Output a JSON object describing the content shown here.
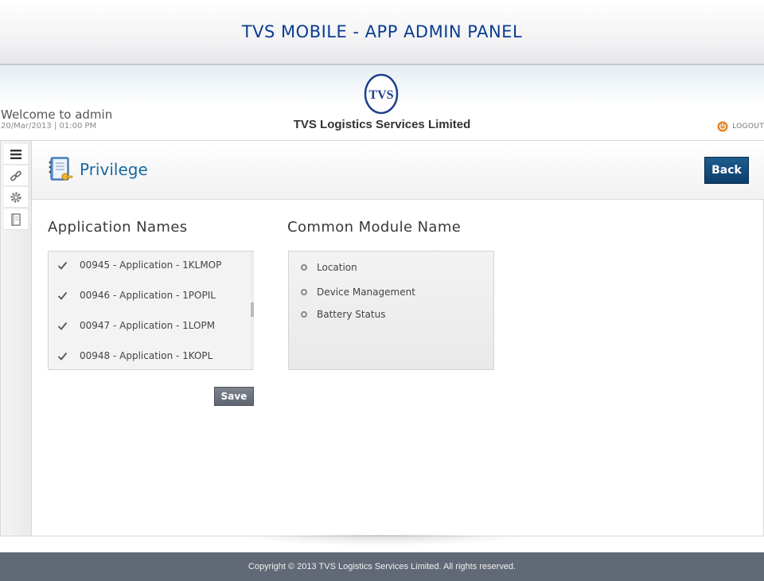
{
  "app": {
    "title": "TVS MOBILE - APP ADMIN PANEL"
  },
  "header": {
    "welcome": "Welcome to admin",
    "datetime": "20/Mar/2013 | 01:00 PM",
    "logo_text": "TVS",
    "company": "TVS Logistics Services Limited",
    "logout": "LOGOUT"
  },
  "sidebar": {
    "items": [
      {
        "icon": "menu-icon"
      },
      {
        "icon": "link-icon"
      },
      {
        "icon": "gear-icon"
      },
      {
        "icon": "notebook-icon"
      }
    ]
  },
  "page": {
    "title": "Privilege",
    "back": "Back",
    "icon": "privilege-notebook-icon"
  },
  "applications": {
    "title": "Application Names",
    "items": [
      {
        "label": "00945 - Application - 1KLMOP",
        "checked": true
      },
      {
        "label": "00946 - Application - 1POPIL",
        "checked": true
      },
      {
        "label": "00947 - Application - 1LOPM",
        "checked": true
      },
      {
        "label": "00948 - Application - 1KOPL",
        "checked": true
      }
    ],
    "save": "Save"
  },
  "modules": {
    "title": "Common Module Name",
    "items": [
      "Location",
      "Device Management",
      "Battery Status"
    ]
  },
  "footer": {
    "text": "Copyright © 2013 TVS Logistics Services Limited. All rights reserved."
  },
  "colors": {
    "title_blue": "#0b3d91",
    "accent_blue": "#1a6a9e",
    "back_button": "#0b3f6c",
    "footer_bg": "#626976",
    "logout_orange": "#e8821e"
  }
}
